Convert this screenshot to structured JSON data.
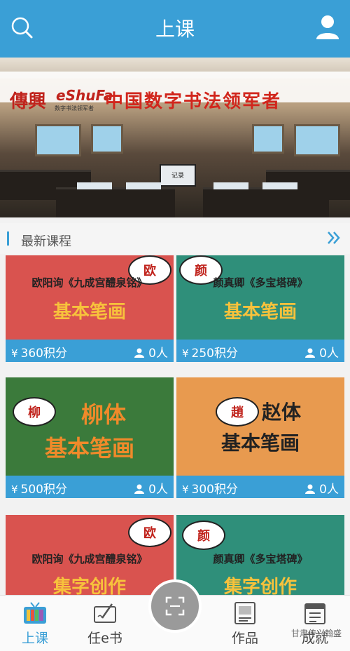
{
  "header": {
    "title": "上课",
    "search_icon": "search-icon",
    "user_icon": "user-icon"
  },
  "banner": {
    "logo_ch": "傳興",
    "logo_en": "eShuFa",
    "logo_sub": "数字书法领军者",
    "slogan": "中国数字书法领军者",
    "screen_text": "记录"
  },
  "section": {
    "title": "最新课程",
    "more_icon": "double-chevron-right-icon"
  },
  "courses": [
    {
      "badge": "欧",
      "title": "欧阳询《九成宫醴泉铭》",
      "subtitle": "基本笔画",
      "price": "360积分",
      "count": "0人",
      "bg": "#d9534f",
      "yen": "¥"
    },
    {
      "badge": "颜",
      "title": "颜真卿《多宝塔碑》",
      "subtitle": "基本笔画",
      "price": "250积分",
      "count": "0人",
      "bg": "#2f8f7a",
      "yen": "¥"
    },
    {
      "badge": "柳",
      "title": "柳体",
      "subtitle": "基本笔画",
      "price": "500积分",
      "count": "0人",
      "bg": "#3b7a3b",
      "yen": "¥"
    },
    {
      "badge": "趙",
      "title": "赵体",
      "subtitle": "基本笔画",
      "price": "300积分",
      "count": "0人",
      "bg": "#e89a4f",
      "yen": "¥"
    },
    {
      "badge": "欧",
      "title": "欧阳询《九成宫醴泉铭》",
      "subtitle": "集字创作",
      "bg": "#d9534f"
    },
    {
      "badge": "颜",
      "title": "颜真卿《多宝塔碑》",
      "subtitle": "集字创作",
      "bg": "#2f8f7a"
    }
  ],
  "tabs": [
    {
      "label": "上课",
      "icon": "tv-icon",
      "active": true
    },
    {
      "label": "任e书",
      "icon": "pen-tablet-icon",
      "active": false
    },
    {
      "label": "作品",
      "icon": "artwork-icon",
      "active": false
    },
    {
      "label": "成就",
      "icon": "calendar-icon",
      "active": false
    }
  ],
  "fab": {
    "icon": "scan-icon"
  },
  "watermark": "甘肃传兴翰盛",
  "colors": {
    "primary": "#3a9fd6",
    "accent_red": "#c0231c"
  }
}
